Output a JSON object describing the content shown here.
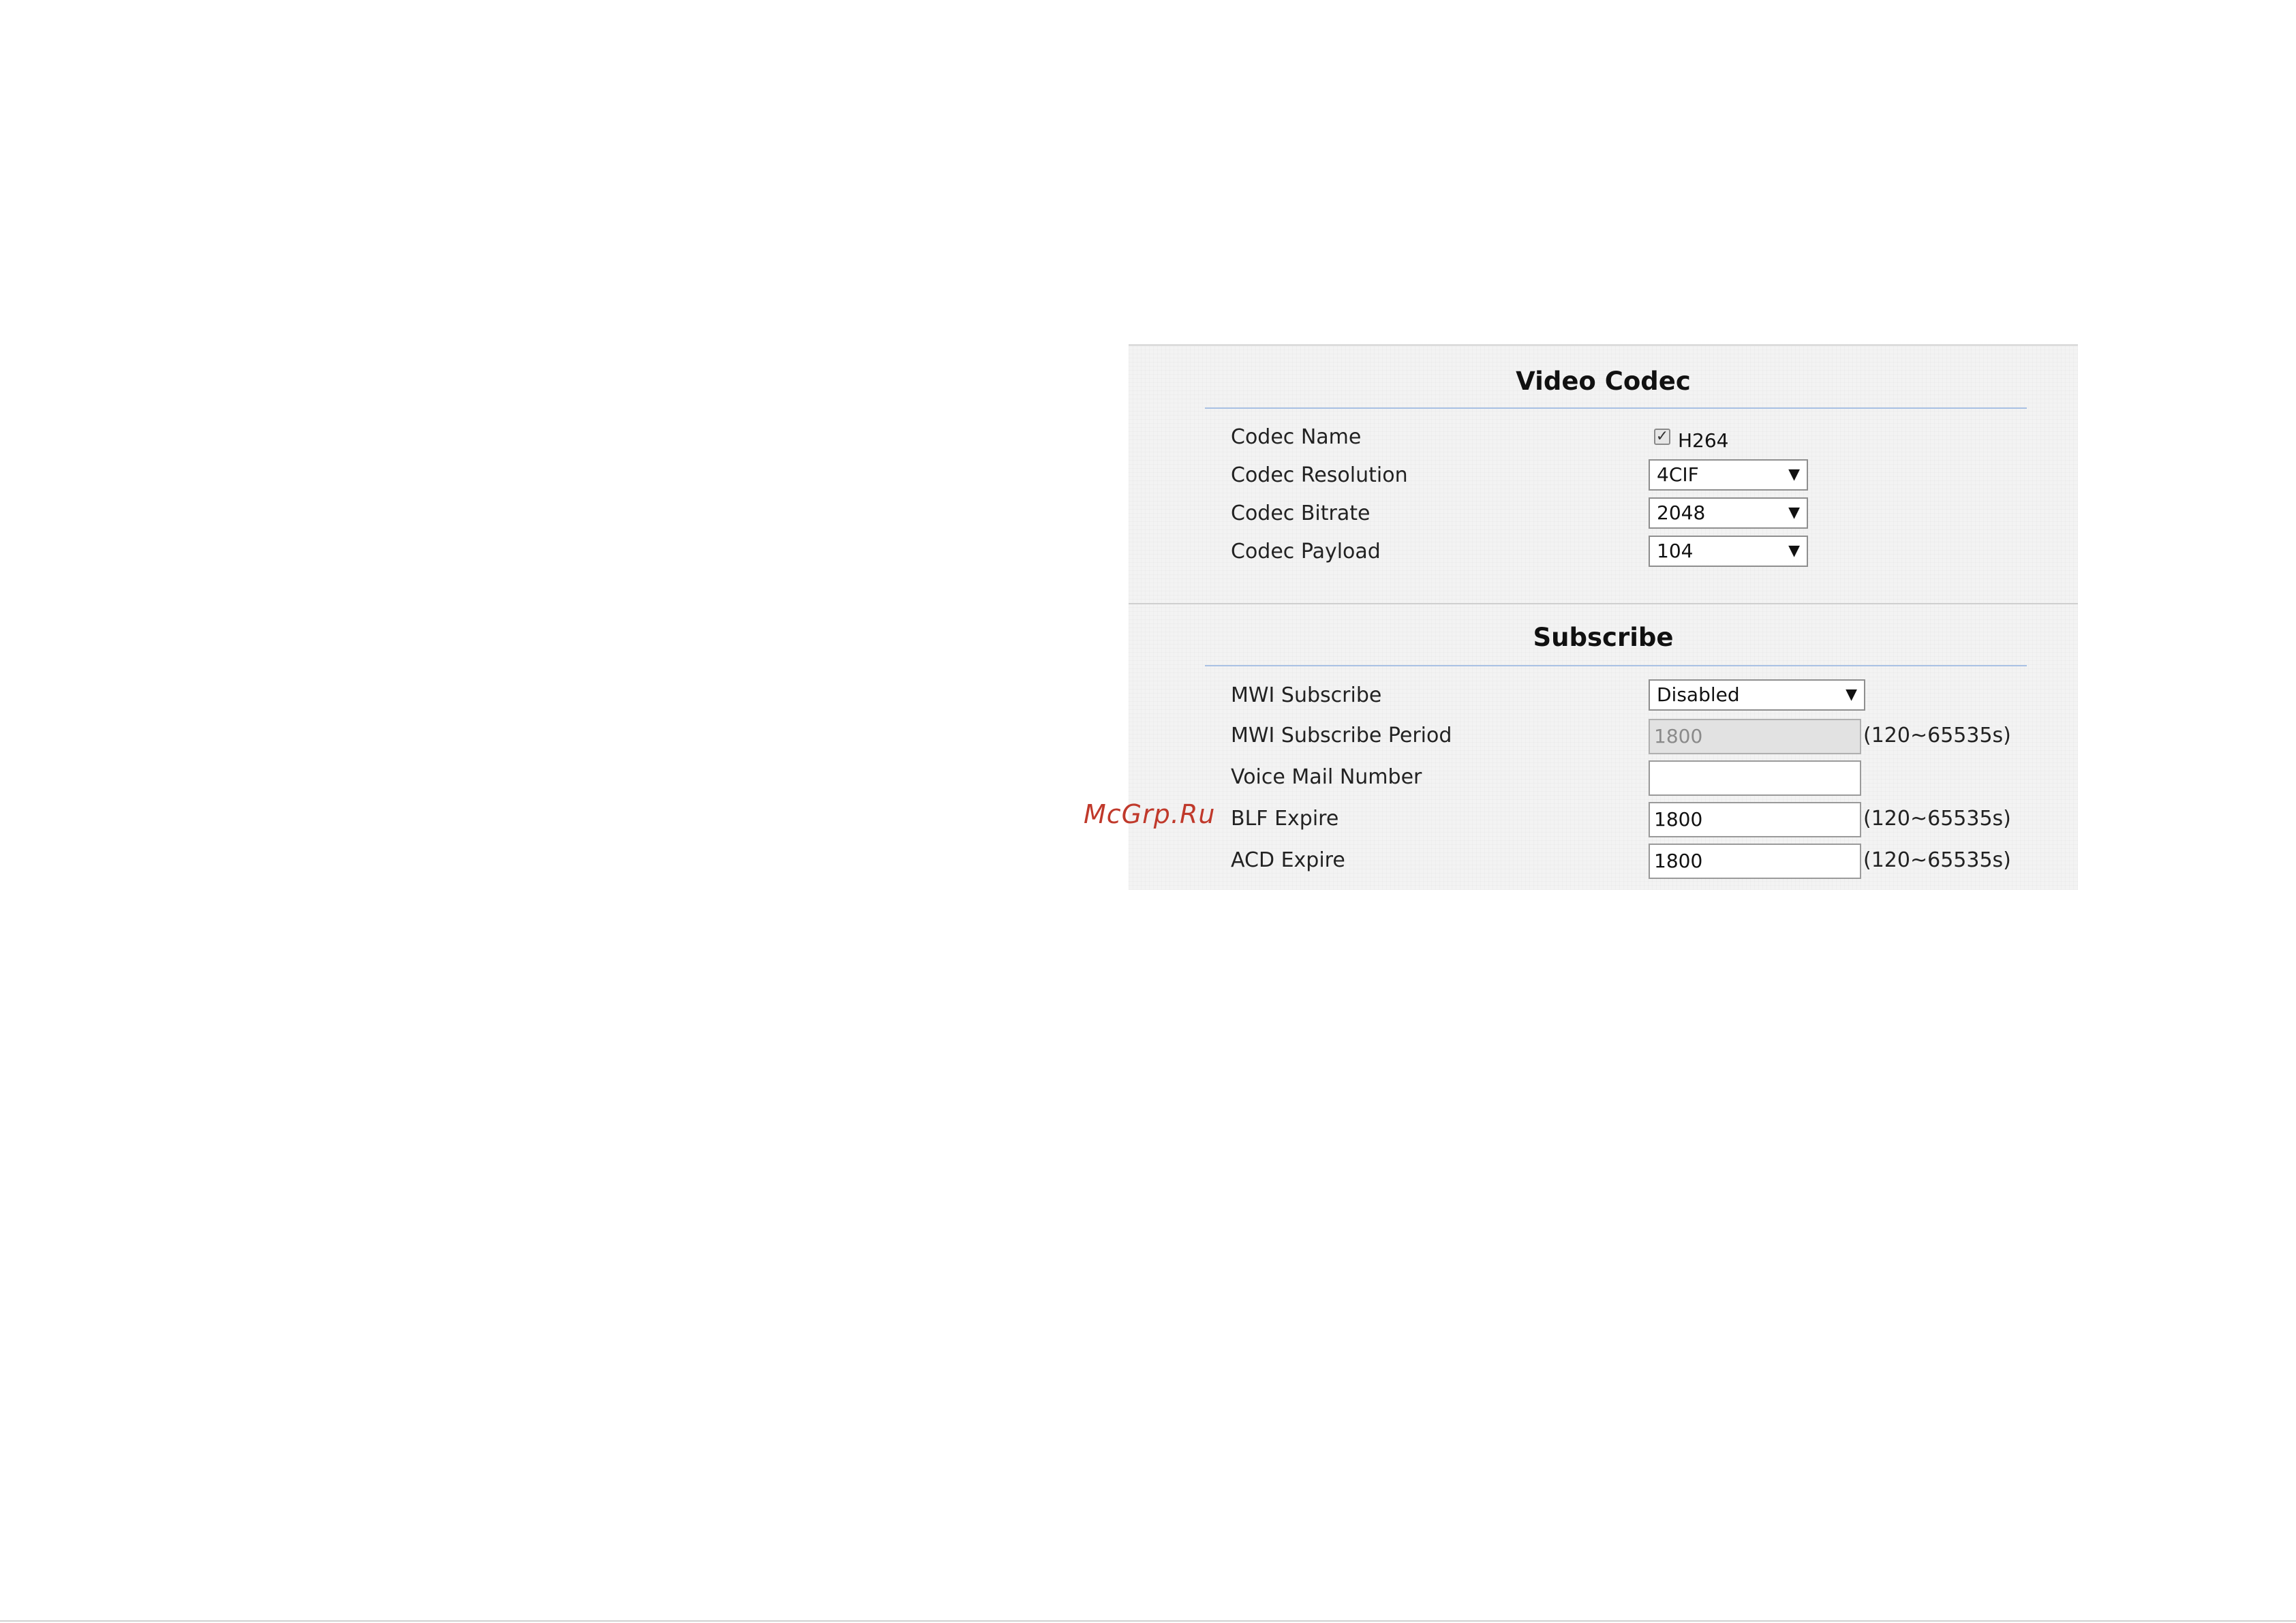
{
  "video_codec": {
    "title": "Video Codec",
    "codec_name": {
      "label": "Codec Name",
      "checkbox_label": "H264",
      "checked": true
    },
    "codec_resolution": {
      "label": "Codec Resolution",
      "value": "4CIF"
    },
    "codec_bitrate": {
      "label": "Codec Bitrate",
      "value": "2048"
    },
    "codec_payload": {
      "label": "Codec Payload",
      "value": "104"
    }
  },
  "subscribe": {
    "title": "Subscribe",
    "mwi_subscribe": {
      "label": "MWI Subscribe",
      "value": "Disabled"
    },
    "mwi_subscribe_period": {
      "label": "MWI Subscribe Period",
      "value": "1800",
      "hint": "(120~65535s)"
    },
    "voice_mail_number": {
      "label": "Voice Mail Number",
      "value": ""
    },
    "blf_expire": {
      "label": "BLF Expire",
      "value": "1800",
      "hint": "(120~65535s)"
    },
    "acd_expire": {
      "label": "ACD Expire",
      "value": "1800",
      "hint": "(120~65535s)"
    }
  },
  "icons": {
    "dropdown": "▼",
    "checkmark": "✓"
  },
  "watermark": "McGrp.Ru"
}
